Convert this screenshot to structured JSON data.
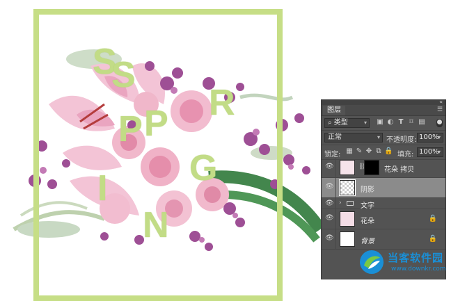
{
  "canvas": {
    "frame_color": "#c6de86",
    "letter_color": "#c2dc86",
    "letters": [
      "S",
      "P",
      "R",
      "I",
      "N",
      "G",
      "S",
      "P",
      "R",
      "I",
      "N",
      "G"
    ]
  },
  "panel": {
    "tab_label": "图层",
    "filter_kind": "类型",
    "blend_mode": "正常",
    "opacity_label": "不透明度:",
    "opacity_value": "100%",
    "lock_label": "锁定:",
    "fill_label": "填充:",
    "fill_value": "100%",
    "layers": [
      {
        "name": "花朵 拷贝",
        "selected": false,
        "has_mask": true
      },
      {
        "name": "阴影",
        "selected": true
      },
      {
        "name": "文字",
        "is_group": true
      },
      {
        "name": "花朵",
        "locked": true
      },
      {
        "name": "背景",
        "locked": true,
        "background": true
      }
    ]
  },
  "watermark": {
    "title": "当客软件园",
    "url": "www.downkr.com",
    "color": "#1a8fd6"
  }
}
